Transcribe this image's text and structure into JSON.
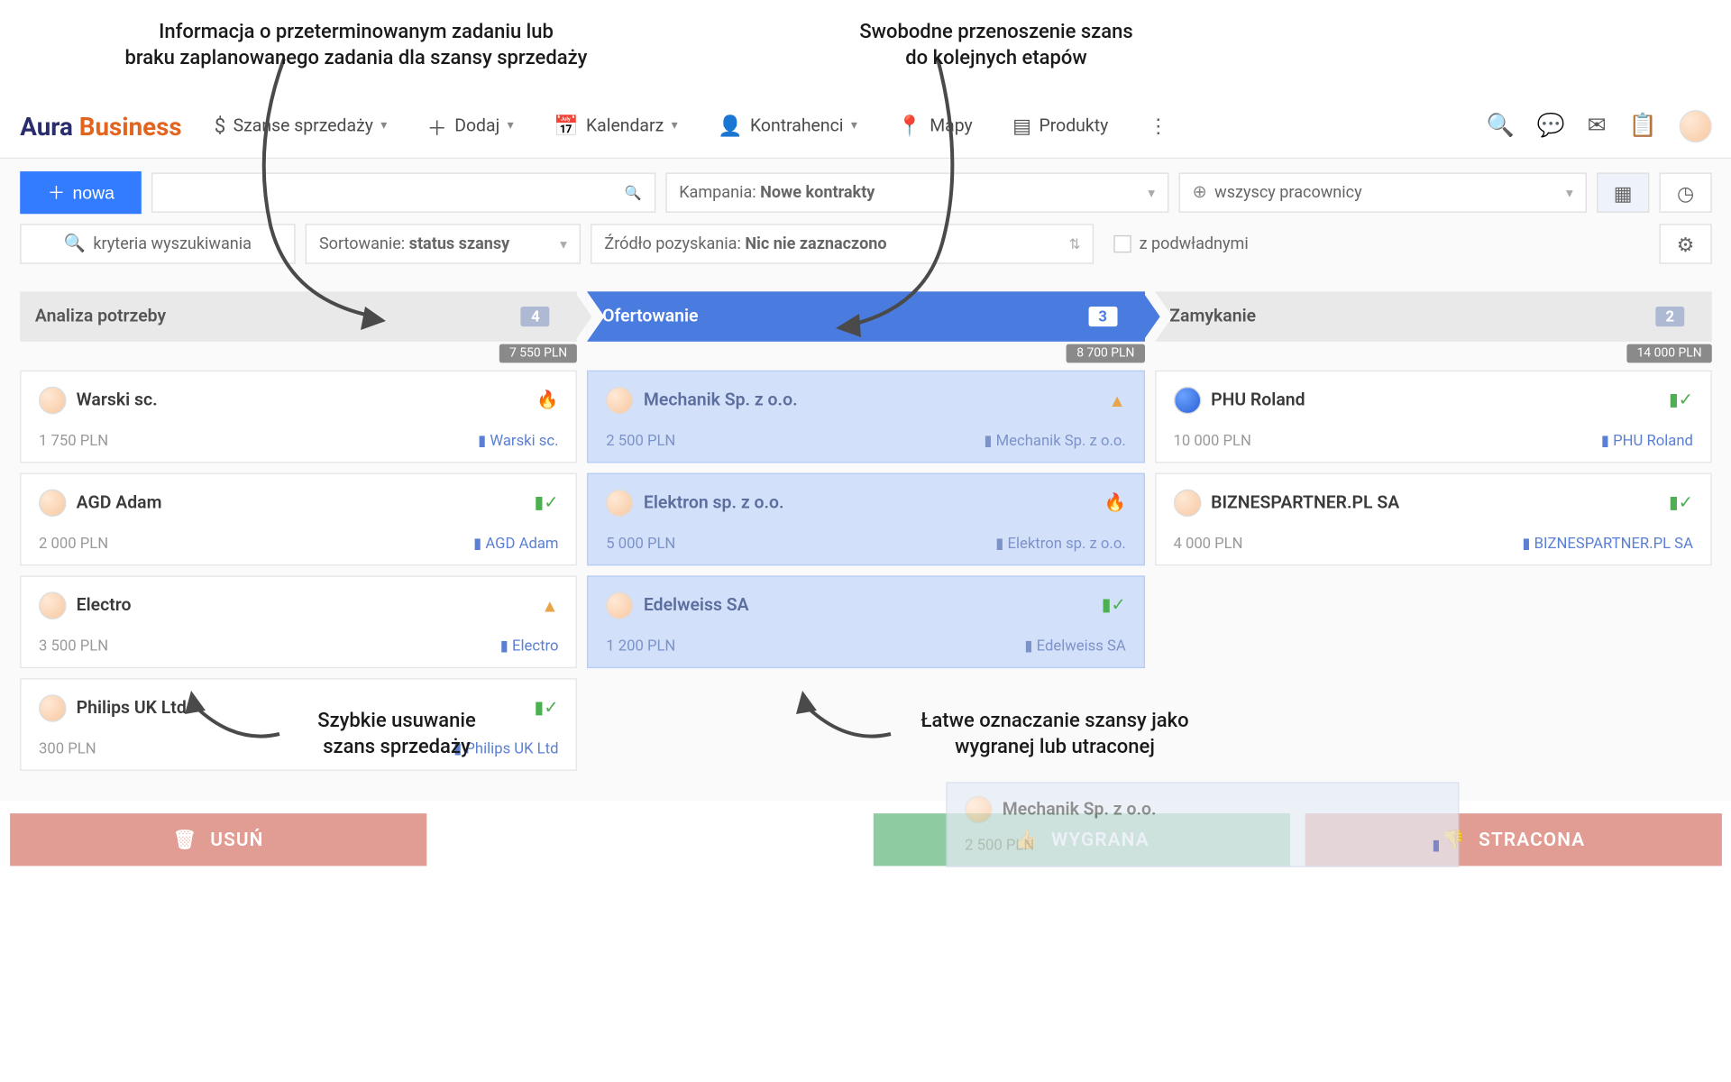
{
  "annotations": {
    "topLeft": "Informacja o przeterminowanym zadaniu lub\nbraku zaplanowanego zadania dla szansy sprzedaży",
    "topRight": "Swobodne przenoszenie szans\ndo kolejnych etapów",
    "botLeft": "Szybkie usuwanie\nszans sprzedaży",
    "botRight": "Łatwe oznaczanie szansy jako\nwygranej lub utraconej"
  },
  "logo": {
    "part1": "Aura",
    "part2": "Business"
  },
  "nav": {
    "szanse": "Szanse sprzedaży",
    "dodaj": "Dodaj",
    "kalendarz": "Kalendarz",
    "kontrahenci": "Kontrahenci",
    "mapy": "Mapy",
    "produkty": "Produkty"
  },
  "tools": {
    "nowa": "nowa",
    "searchPlaceholder": "",
    "kampaniaLbl": "Kampania:",
    "kampaniaVal": "Nowe kontrakty",
    "pracownicy": "wszyscy pracownicy",
    "kryteria": "kryteria wyszukiwania",
    "sortLbl": "Sortowanie:",
    "sortVal": "status szansy",
    "zrodloLbl": "Źródło pozyskania:",
    "zrodloVal": "Nic nie zaznaczono",
    "podwladni": "z podwładnymi"
  },
  "columns": [
    {
      "title": "Analiza potrzeby",
      "count": "4",
      "sum": "7 550 PLN",
      "active": false,
      "cards": [
        {
          "name": "Warski sc.",
          "price": "1 750 PLN",
          "link": "Warski sc.",
          "status": "fire"
        },
        {
          "name": "AGD Adam",
          "price": "2 000 PLN",
          "link": "AGD Adam",
          "status": "ok"
        },
        {
          "name": "Electro",
          "price": "3 500 PLN",
          "link": "Electro",
          "status": "warn"
        },
        {
          "name": "Philips UK Ltd",
          "price": "300 PLN",
          "link": "Philips UK Ltd",
          "status": "ok"
        }
      ]
    },
    {
      "title": "Ofertowanie",
      "count": "3",
      "sum": "8 700 PLN",
      "active": true,
      "cards": [
        {
          "name": "Mechanik Sp. z o.o.",
          "price": "2 500 PLN",
          "link": "Mechanik Sp. z o.o.",
          "status": "warn"
        },
        {
          "name": "Elektron sp. z o.o.",
          "price": "5 000 PLN",
          "link": "Elektron sp. z o.o.",
          "status": "fire"
        },
        {
          "name": "Edelweiss SA",
          "price": "1 200 PLN",
          "link": "Edelweiss SA",
          "status": "ok"
        }
      ]
    },
    {
      "title": "Zamykanie",
      "count": "2",
      "sum": "14 000 PLN",
      "active": false,
      "cards": [
        {
          "name": "PHU Roland",
          "price": "10 000 PLN",
          "link": "PHU Roland",
          "status": "ok",
          "avatar": "blue"
        },
        {
          "name": "BIZNESPARTNER.PL SA",
          "price": "4 000 PLN",
          "link": "BIZNESPARTNER.PL SA",
          "status": "ok"
        }
      ]
    }
  ],
  "ghost": {
    "name": "Mechanik Sp. z o.o.",
    "price": "2 500 PLN"
  },
  "buttons": {
    "usun": "USUŃ",
    "wygrana": "WYGRANA",
    "stracona": "STRACONA"
  }
}
